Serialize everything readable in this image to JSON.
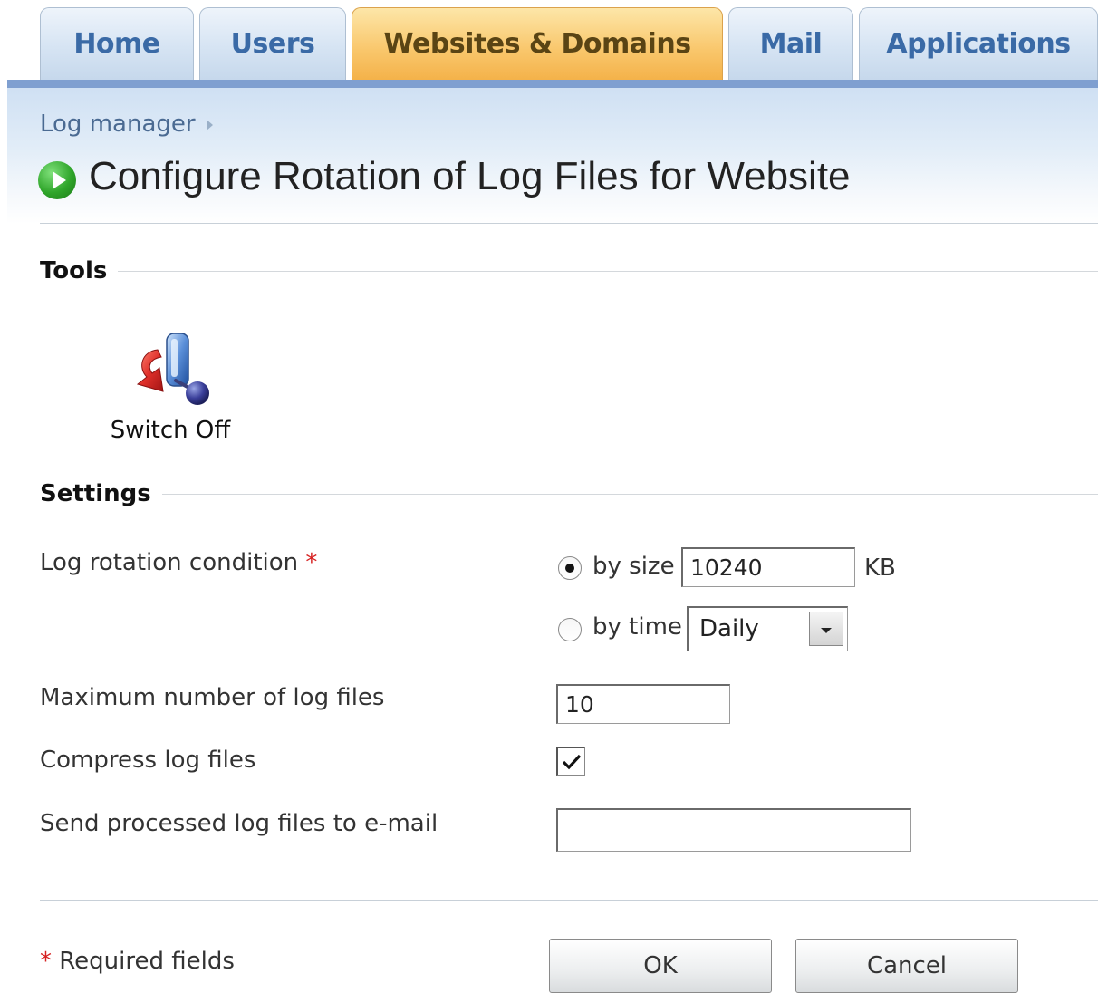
{
  "tabs": [
    {
      "label": "Home",
      "active": false
    },
    {
      "label": "Users",
      "active": false
    },
    {
      "label": "Websites & Domains",
      "active": true
    },
    {
      "label": "Mail",
      "active": false
    },
    {
      "label": "Applications",
      "active": false
    }
  ],
  "breadcrumb": {
    "item": "Log manager"
  },
  "page": {
    "title": "Configure Rotation of Log Files for Website"
  },
  "tools": {
    "section_title": "Tools",
    "items": [
      {
        "label": "Switch Off",
        "icon": "switch-off-icon"
      }
    ]
  },
  "settings": {
    "section_title": "Settings",
    "rotation": {
      "label": "Log rotation condition",
      "required_mark": "*",
      "by_size": {
        "label": "by size",
        "value": "10240",
        "unit": "KB",
        "checked": true
      },
      "by_time": {
        "label": "by time",
        "value": "Daily",
        "checked": false
      }
    },
    "max_files": {
      "label": "Maximum number of log files",
      "value": "10"
    },
    "compress": {
      "label": "Compress log files",
      "checked": true
    },
    "email": {
      "label": "Send processed log files to e-mail",
      "value": ""
    }
  },
  "footer": {
    "required_mark": "*",
    "required_text": "Required fields",
    "ok_label": "OK",
    "cancel_label": "Cancel"
  },
  "colors": {
    "active_tab": "#f9c66a",
    "tab": "#d6e4f3",
    "tab_text": "#3a6aa6",
    "required": "#d62020"
  }
}
